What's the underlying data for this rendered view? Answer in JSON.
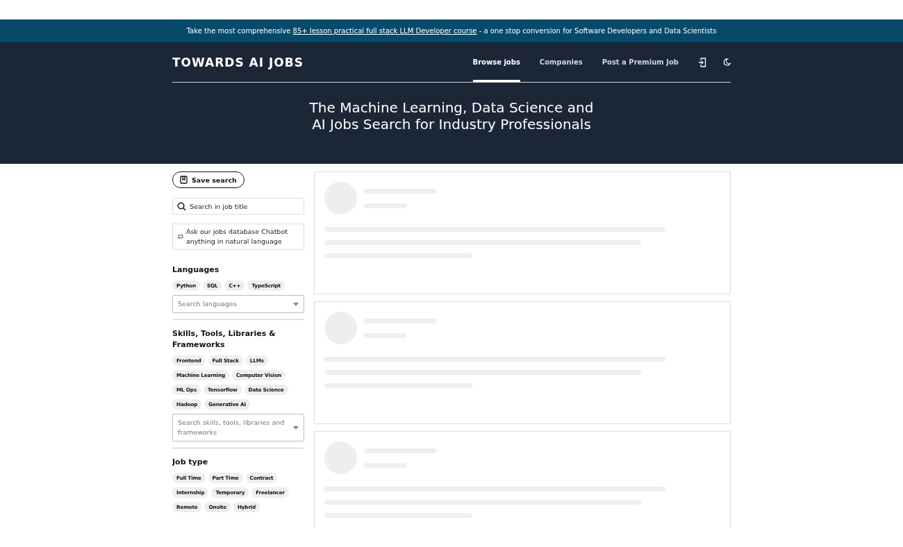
{
  "banner": {
    "before": "Take the most comprehensive",
    "link": "85+ lesson practical full stack LLM Developer course",
    "after": "- a one stop conversion for Software Developers and Data Scientists"
  },
  "header": {
    "logo": "TOWARDS AI JOBS",
    "nav": [
      {
        "label": "Browse jobs",
        "selected": true
      },
      {
        "label": "Companies",
        "selected": false
      },
      {
        "label": "Post a Premium Job",
        "selected": false
      }
    ],
    "title": "The Machine Learning, Data Science and AI Jobs Search for Industry Professionals"
  },
  "sidebar": {
    "save_button": "Save search",
    "search": {
      "placeholder": "Search in job title"
    },
    "chatbot": "Ask our jobs database Chatbot anything in natural language",
    "filters": [
      {
        "title": "Languages",
        "chips": [
          "Python",
          "SQL",
          "C++",
          "TypeScript"
        ],
        "placeholder": "Search languages"
      },
      {
        "title": "Skills, Tools, Libraries & Frameworks",
        "chips": [
          "Frontend",
          "Full Stack",
          "LLMs",
          "Machine Learning",
          "Computer Vision",
          "ML Ops",
          "Tensorflow",
          "Data Science",
          "Hadoop",
          "Generative AI"
        ],
        "placeholder": "Search skills, tools, libraries and frameworks"
      },
      {
        "title": "Job type",
        "chips": [
          "Full Time",
          "Part Time",
          "Contract",
          "Internship",
          "Temporary",
          "Freelancer",
          "Remote",
          "Onsite",
          "Hybrid"
        ]
      }
    ]
  },
  "job_list": [
    {
      "kind": "skeleton"
    },
    {
      "kind": "skeleton"
    },
    {
      "kind": "skeleton"
    }
  ]
}
